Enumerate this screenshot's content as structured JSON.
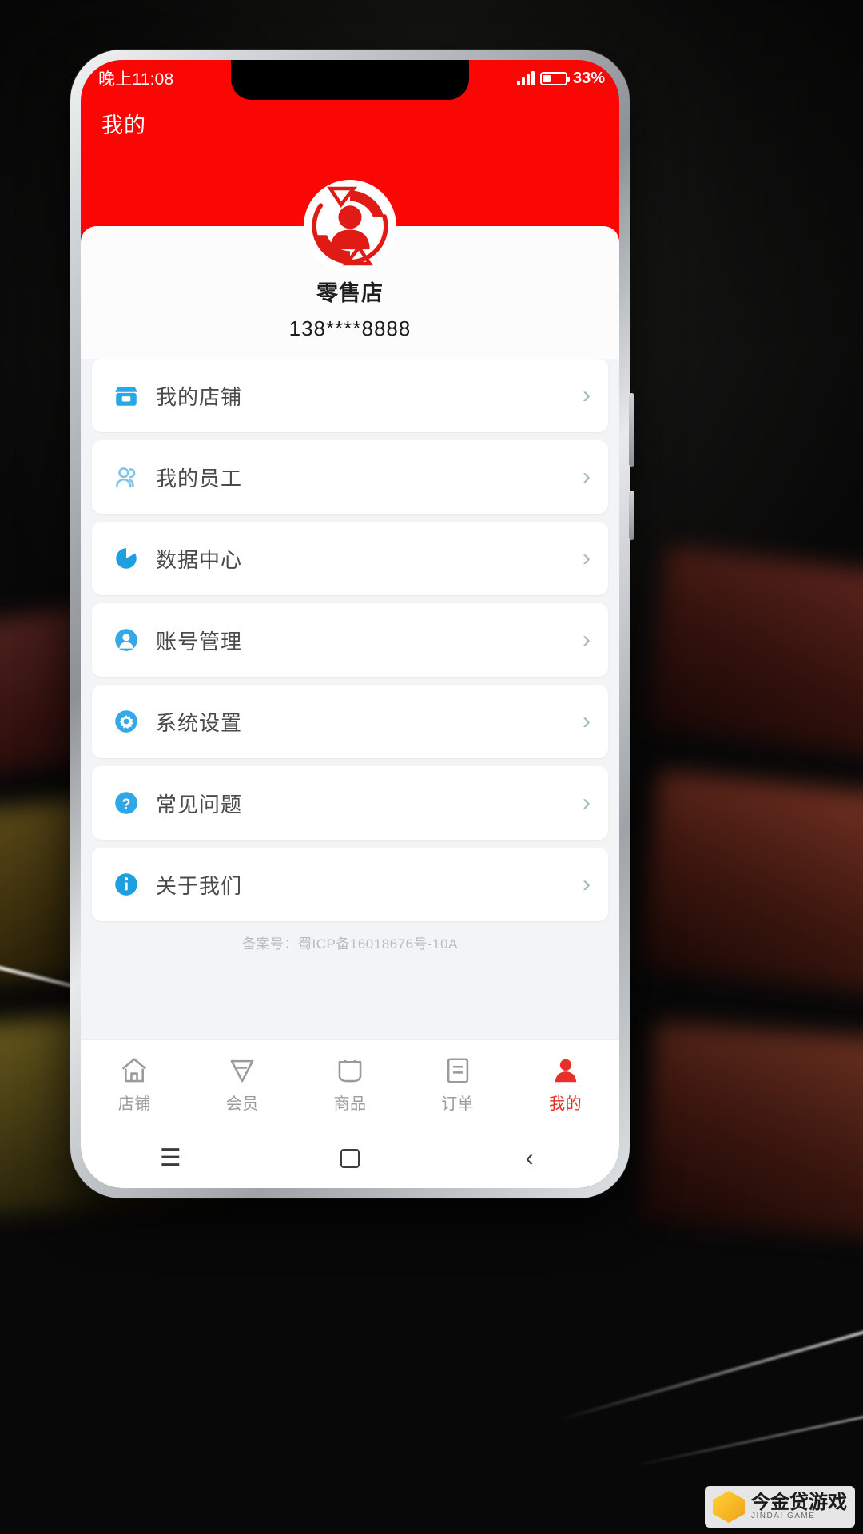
{
  "statusbar": {
    "time": "晚上11:08",
    "battery_percent": "33%",
    "battery_level": 33,
    "signal_icon": "signal-bars-icon",
    "battery_icon": "battery-icon"
  },
  "header": {
    "title": "我的",
    "brand_color": "#fb0505"
  },
  "profile": {
    "avatar_icon": "user-refresh-avatar-icon",
    "name": "零售店",
    "phone": "138****8888"
  },
  "menu": {
    "items": [
      {
        "label": "我的店铺",
        "icon": "shop-icon",
        "chevron": "›",
        "icon_color": "#29a7e8"
      },
      {
        "label": "我的员工",
        "icon": "people-icon",
        "chevron": "›",
        "icon_color": "#7fc4e8"
      },
      {
        "label": "数据中心",
        "icon": "pie-chart-icon",
        "chevron": "›",
        "icon_color": "#1e9fe0"
      },
      {
        "label": "账号管理",
        "icon": "account-icon",
        "chevron": "›",
        "icon_color": "#34a9e8"
      },
      {
        "label": "系统设置",
        "icon": "gear-icon",
        "chevron": "›",
        "icon_color": "#34a9e8"
      },
      {
        "label": "常见问题",
        "icon": "question-icon",
        "chevron": "›",
        "icon_color": "#2ea6e8"
      },
      {
        "label": "关于我们",
        "icon": "info-icon",
        "chevron": "›",
        "icon_color": "#1e9fe0"
      }
    ]
  },
  "footer": {
    "icp": "备案号：蜀ICP备16018676号-10A"
  },
  "tabbar": {
    "active_color": "#e8302b",
    "items": [
      {
        "label": "店铺",
        "icon": "home-icon",
        "active": false
      },
      {
        "label": "会员",
        "icon": "member-icon",
        "active": false
      },
      {
        "label": "商品",
        "icon": "bag-icon",
        "active": false
      },
      {
        "label": "订单",
        "icon": "order-icon",
        "active": false
      },
      {
        "label": "我的",
        "icon": "person-icon",
        "active": true
      }
    ]
  },
  "androidnav": {
    "menu": "☰",
    "home": "home-square-icon",
    "back": "‹"
  },
  "watermark": {
    "title": "今金贷游戏",
    "subtitle": "JINDAI GAME"
  }
}
